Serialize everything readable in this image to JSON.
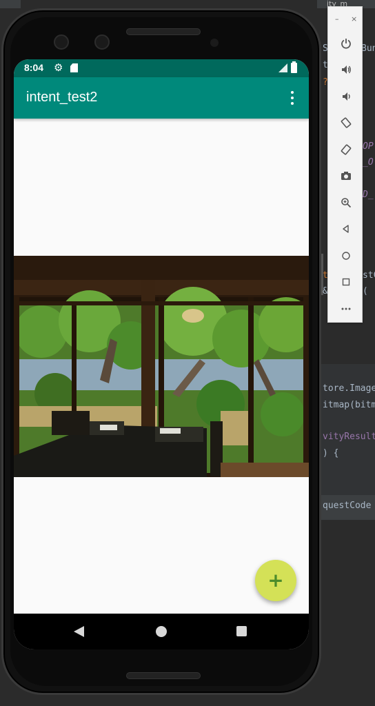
{
  "ide": {
    "tab_fragment": "ity_m",
    "code_lines": [
      {
        "text": "S",
        "color": "#a9b7c6"
      },
      {
        "text": "t",
        "color": "#a9b7c6"
      },
      {
        "text": "?",
        "color": "#cc7832"
      },
      {
        "text": "OP",
        "color": "#9876aa"
      },
      {
        "text": "_O",
        "color": "#9876aa"
      },
      {
        "text": "D_",
        "color": "#9876aa"
      },
      {
        "text": "t",
        "color": "#cc7832"
      },
      {
        "text": "& ",
        "color": "#a9b7c6"
      },
      {
        "text": "tore.Image",
        "color": "#a9b7c6"
      },
      {
        "text": "itmap(bitm",
        "color": "#a9b7c6"
      },
      {
        "text": "vityResult",
        "color": "#9876aa"
      },
      {
        "text": ") {",
        "color": "#a9b7c6"
      },
      {
        "text": "questCode",
        "color": "#a9b7c6"
      }
    ],
    "right_fragments": [
      {
        "text": "Bun",
        "color": "#a9b7c6"
      },
      {
        "text": "stC",
        "color": "#a9b7c6"
      },
      {
        "text": "( ",
        "color": "#a9b7c6"
      }
    ]
  },
  "status_bar": {
    "time": "8:04",
    "gear_icon": "settings-icon",
    "sd_icon": "sd-card-icon",
    "signal_icon": "signal-icon",
    "battery_icon": "battery-icon"
  },
  "app_bar": {
    "title": "intent_test2",
    "overflow_icon": "more-vert-icon"
  },
  "fab": {
    "label": "+"
  },
  "emulator_toolbar": {
    "minimize": "–",
    "close": "×",
    "buttons": [
      "power",
      "volume-up",
      "volume-down",
      "rotate-left",
      "rotate-right",
      "screenshot",
      "zoom",
      "back",
      "home",
      "overview",
      "more"
    ]
  },
  "colors": {
    "status_bar": "#00695c",
    "app_bar": "#00897b",
    "fab": "#d4e157",
    "fab_icon": "#4c8c2b",
    "screen_bg": "#fafafa"
  }
}
